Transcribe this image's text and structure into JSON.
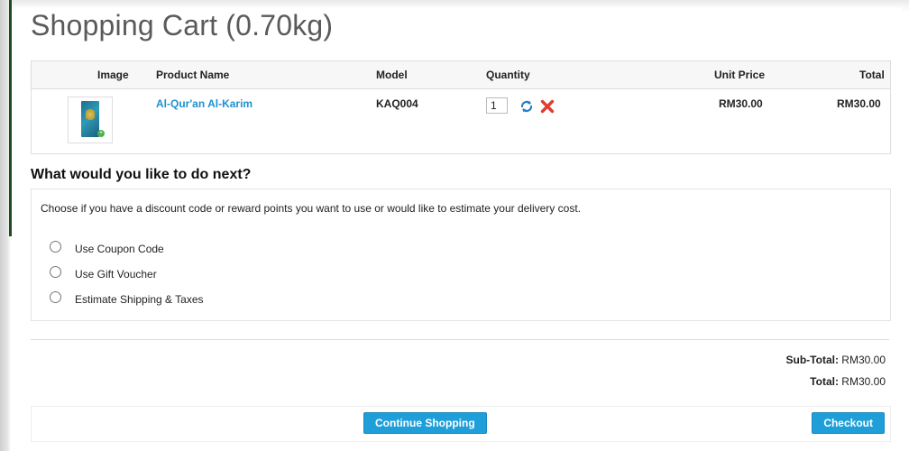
{
  "page": {
    "title": "Shopping Cart  (0.70kg)"
  },
  "cart": {
    "headers": {
      "image": "Image",
      "product_name": "Product Name",
      "model": "Model",
      "quantity": "Quantity",
      "unit_price": "Unit Price",
      "total": "Total"
    },
    "items": [
      {
        "product_name": "Al-Qur'an Al-Karim",
        "model": "KAQ004",
        "quantity": "1",
        "unit_price": "RM30.00",
        "total": "RM30.00"
      }
    ]
  },
  "next": {
    "heading": "What would you like to do next?",
    "description": "Choose if you have a discount code or reward points you want to use or would like to estimate your delivery cost.",
    "options": [
      "Use Coupon Code",
      "Use Gift Voucher",
      "Estimate Shipping & Taxes"
    ]
  },
  "totals": {
    "subtotal_label": "Sub-Total:",
    "subtotal_value": "RM30.00",
    "total_label": "Total:",
    "total_value": "RM30.00"
  },
  "actions": {
    "continue_label": "Continue Shopping",
    "checkout_label": "Checkout"
  },
  "colors": {
    "link": "#1e91cf",
    "button": "#1f9fd9",
    "remove": "#e43b2f",
    "update": "#2b7ec1"
  },
  "icons": {
    "update": "refresh-icon",
    "remove": "remove-icon"
  }
}
